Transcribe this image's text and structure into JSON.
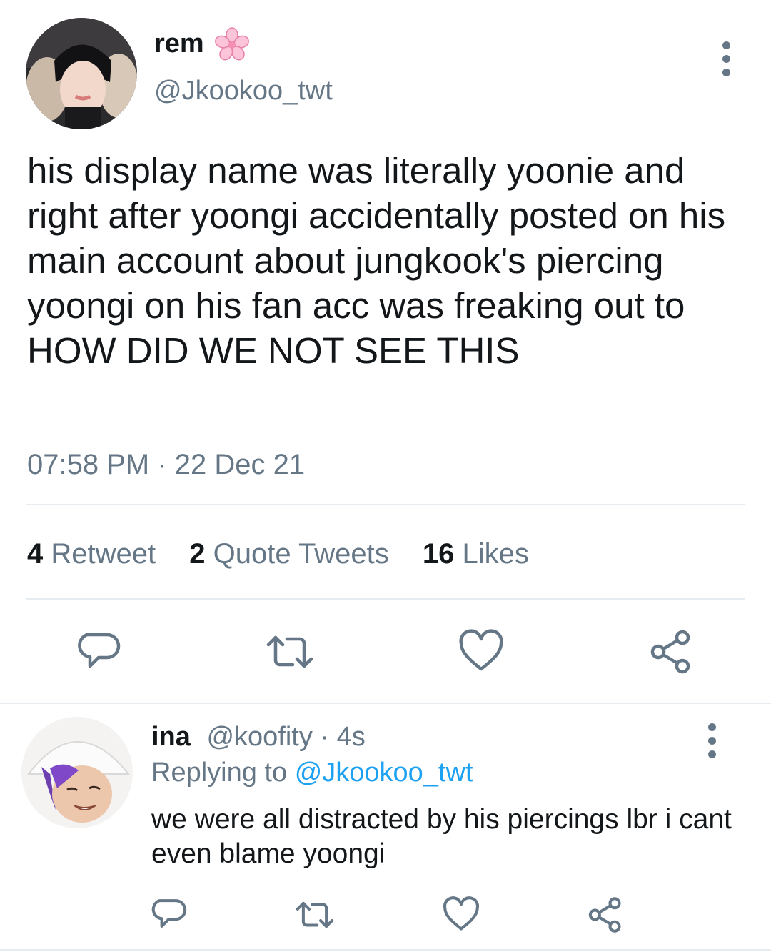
{
  "tweet": {
    "author": {
      "name": "rem",
      "badge_emoji": "🌸",
      "handle": "@Jkookoo_twt"
    },
    "text": "his display name was literally yoonie and right after yoongi accidentally posted on his main account about jungkook's piercing yoongi on his fan acc was freaking out to HOW DID WE NOT SEE THIS",
    "time": "07:58 PM",
    "separator": "·",
    "date": "22 Dec 21",
    "stats": {
      "retweets": "4",
      "retweets_label": "Retweet",
      "quotes": "2",
      "quotes_label": "Quote Tweets",
      "likes": "16",
      "likes_label": "Likes"
    },
    "actions": [
      "comment-icon",
      "retweet-icon",
      "heart-icon",
      "share-icon"
    ]
  },
  "reply": {
    "author": {
      "name": "ina",
      "handle": "@koofity",
      "separator": "·",
      "age": "4s"
    },
    "replying_prefix": "Replying to",
    "replying_handle": "@Jkookoo_twt",
    "text": "we were all distracted by his piercings lbr i cant even blame yoongi",
    "actions": [
      "comment-icon",
      "retweet-icon",
      "heart-icon",
      "share-icon"
    ]
  },
  "colors": {
    "text": "#14171a",
    "secondary": "#657786",
    "link": "#1da1f2",
    "divider": "#e6ecf0",
    "icon": "#657786",
    "badge": "#f7a8c8"
  }
}
